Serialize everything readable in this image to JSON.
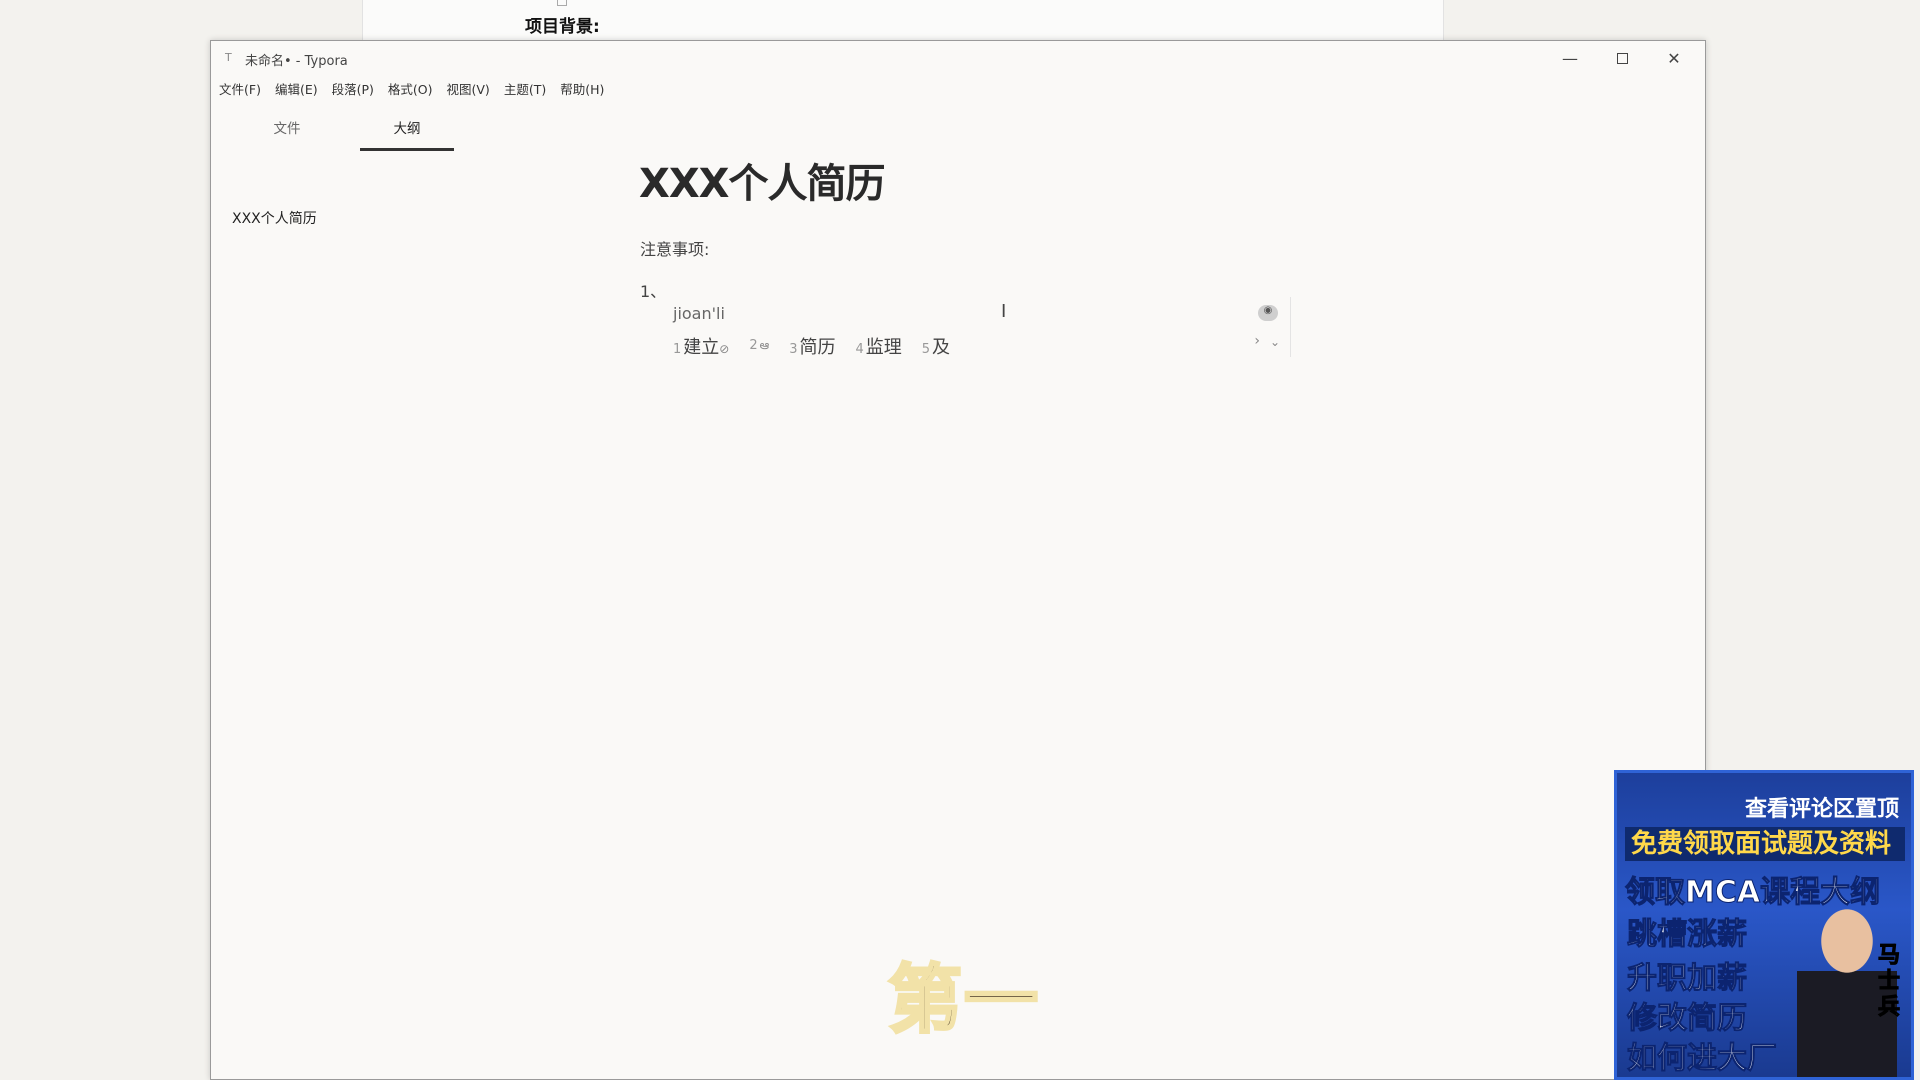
{
  "background_doc": {
    "heading": "项目背景:"
  },
  "window": {
    "app_icon": "T",
    "title": "未命名• - Typora",
    "controls": {
      "minimize": "—",
      "close": "✕"
    }
  },
  "menu": [
    "文件(F)",
    "编辑(E)",
    "段落(P)",
    "格式(O)",
    "视图(V)",
    "主题(T)",
    "帮助(H)"
  ],
  "sidebar": {
    "tabs": {
      "files": "文件",
      "outline": "大纲"
    },
    "outline_items": [
      "XXX个人简历"
    ]
  },
  "document": {
    "title": "XXX个人简历",
    "notes_label": "注意事项:",
    "list_number": "1、"
  },
  "ime": {
    "pinyin": "jioan'li",
    "candidates": [
      {
        "num": "1",
        "text": "建立",
        "sym": "⊘"
      },
      {
        "num": "2",
        "text": "",
        "sym": "ఆ"
      },
      {
        "num": "3",
        "text": "简历",
        "sym": ""
      },
      {
        "num": "4",
        "text": "监理",
        "sym": ""
      },
      {
        "num": "5",
        "text": "及",
        "sym": ""
      }
    ],
    "next": "›",
    "expand": "⌄"
  },
  "subtitle": "第一",
  "promo": {
    "top": "查看评论区置顶",
    "line1": "免费领取面试题及资料",
    "line2": "领取MCA课程大纲",
    "items": [
      "跳槽涨薪",
      "升职加薪",
      "修改简历",
      "如何进大厂"
    ],
    "name": "马士兵"
  },
  "colors": {
    "window_bg": "#faf9f7",
    "subtitle_text": "#3b2d1e",
    "subtitle_stroke": "#f2e2a8",
    "promo_bg": "#2a57c8",
    "promo_accent": "#ffd84a"
  }
}
